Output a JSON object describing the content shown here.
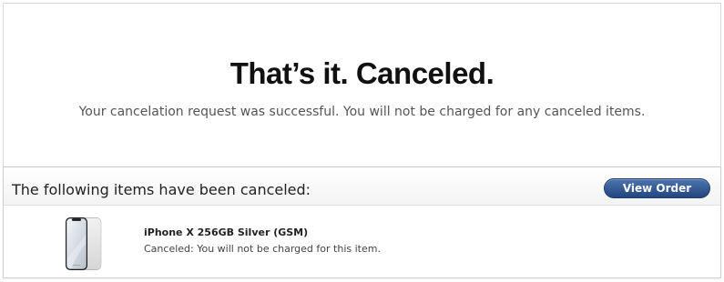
{
  "hero": {
    "title": "That’s it. Canceled.",
    "subtitle": "Your cancelation request was successful. You will not be charged for any canceled items."
  },
  "items_section": {
    "heading": "The following items have been canceled:",
    "view_order_label": "View Order",
    "items": [
      {
        "name": "iPhone X 256GB Silver (GSM)",
        "status": "Canceled: You will not be charged for this item.",
        "thumbnail_icon": "iphone-x-silver-icon"
      }
    ]
  },
  "colors": {
    "button_top": "#4d74ad",
    "button_bottom": "#23467f",
    "title": "#111111",
    "border": "#d9d9d9"
  }
}
